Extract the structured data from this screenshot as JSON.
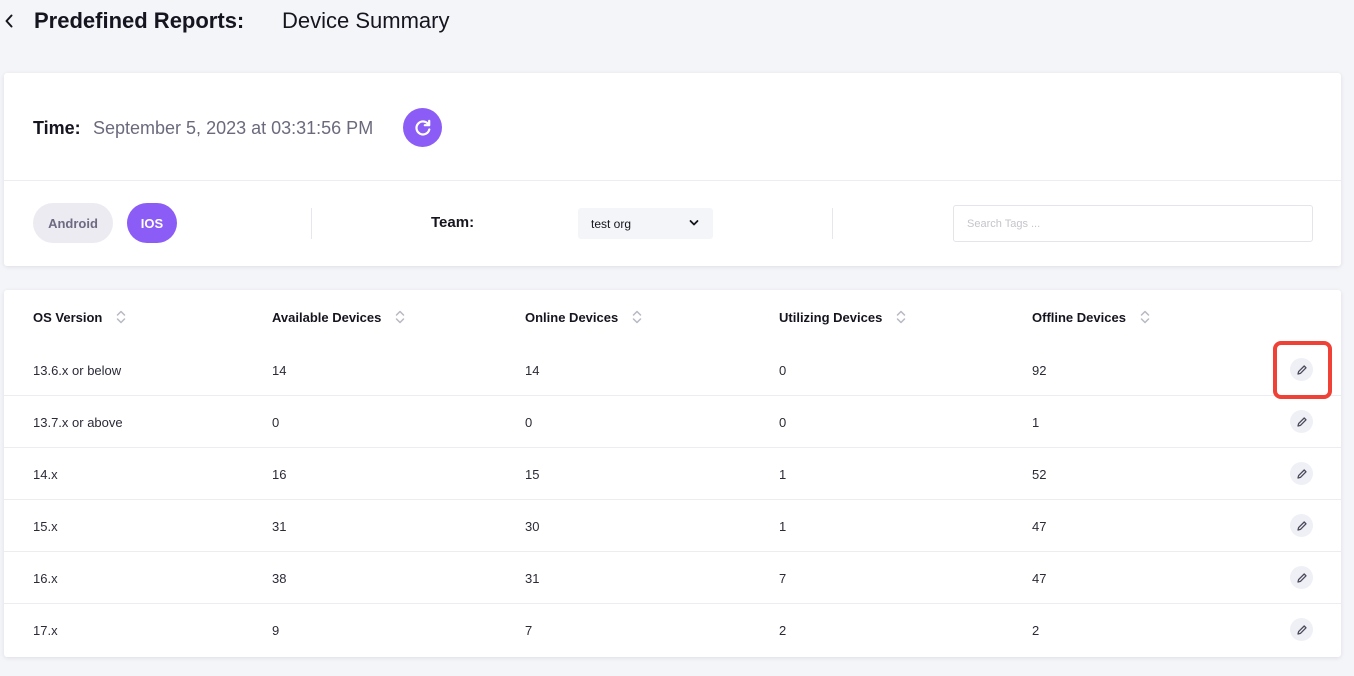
{
  "header": {
    "title": "Predefined Reports:",
    "subtitle": "Device Summary",
    "back_icon": "chevron-left-icon"
  },
  "filters": {
    "time_label": "Time:",
    "time_value": "September 5, 2023 at 03:31:56 PM",
    "refresh_icon": "refresh-icon",
    "os_options": [
      "Android",
      "IOS"
    ],
    "os_selected": "IOS",
    "team_label": "Team:",
    "team_value": "test org",
    "search_placeholder": "Search Tags ...",
    "search_value": ""
  },
  "table": {
    "columns": [
      "OS Version",
      "Available Devices",
      "Online Devices",
      "Utilizing Devices",
      "Offline Devices"
    ],
    "rows": [
      [
        "13.6.x or below",
        "14",
        "14",
        "0",
        "92"
      ],
      [
        "13.7.x or above",
        "0",
        "0",
        "0",
        "1"
      ],
      [
        "14.x",
        "16",
        "15",
        "1",
        "52"
      ],
      [
        "15.x",
        "31",
        "30",
        "1",
        "47"
      ],
      [
        "16.x",
        "38",
        "31",
        "7",
        "47"
      ],
      [
        "17.x",
        "9",
        "7",
        "2",
        "2"
      ]
    ],
    "row_action_icon": "pencil-icon",
    "highlighted_row": 0
  },
  "colors": {
    "accent": "#8b5cf6",
    "highlight": "#ef4136",
    "background": "#f4f5f9"
  }
}
